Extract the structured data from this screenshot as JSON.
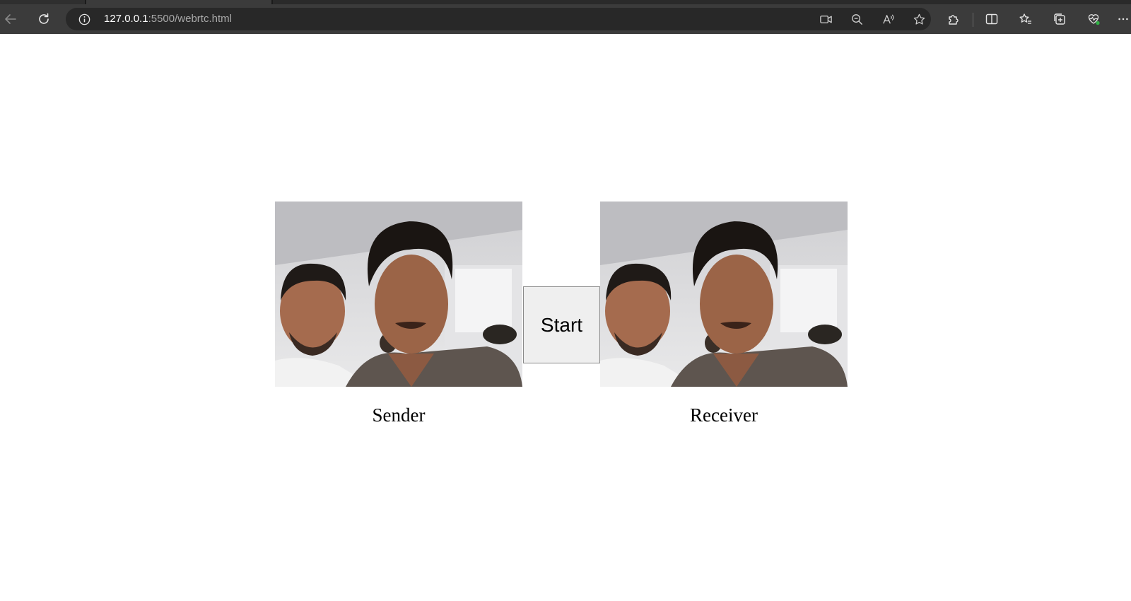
{
  "browser": {
    "url_host": "127.0.0.1",
    "url_path": ":5500/webrtc.html",
    "icons": {
      "back": "back-arrow-icon",
      "refresh": "refresh-icon",
      "info": "info-icon",
      "camera": "camera-icon",
      "zoom": "zoom-out-icon",
      "read_aloud": "read-aloud-icon",
      "favorite": "star-icon",
      "extensions": "extensions-icon",
      "split_screen": "split-screen-icon",
      "favorites": "favorites-icon",
      "collections": "collections-icon",
      "performance": "heart-monitor-icon",
      "more": "more-icon"
    }
  },
  "page": {
    "start_label": "Start",
    "sender_label": "Sender",
    "receiver_label": "Receiver"
  }
}
